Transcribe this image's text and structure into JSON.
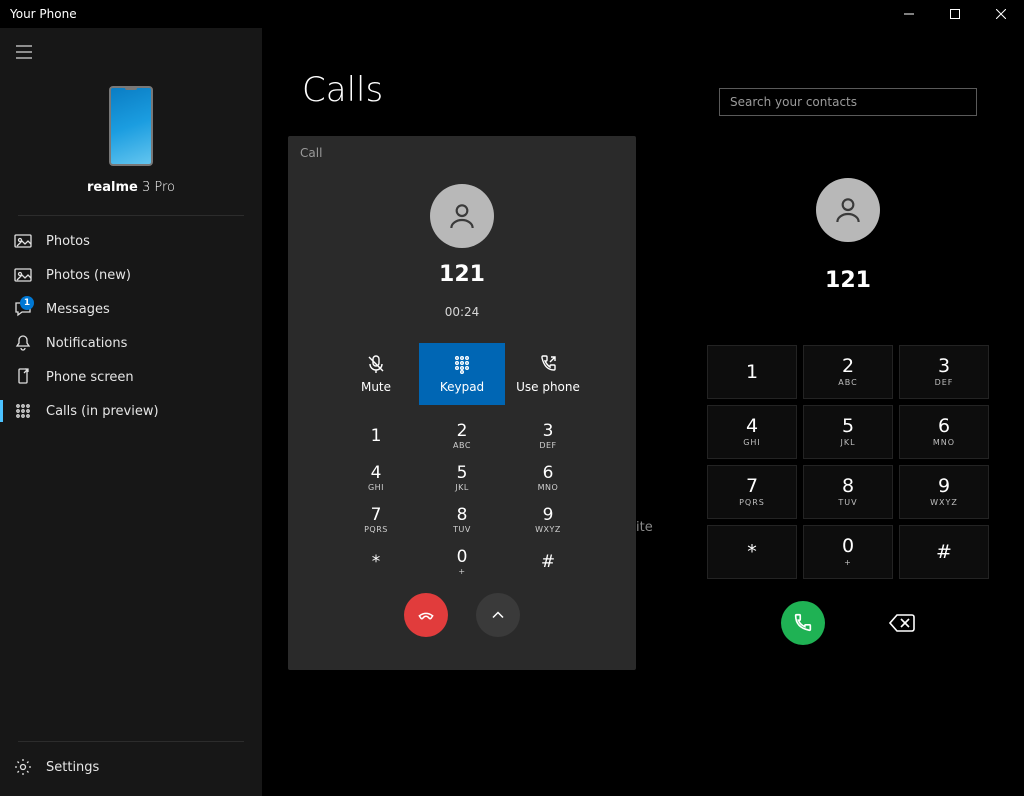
{
  "titlebar": {
    "title": "Your Phone"
  },
  "sidebar": {
    "phone_name_bold": "realme",
    "phone_name_light": " 3 Pro",
    "items": [
      {
        "label": "Photos"
      },
      {
        "label": "Photos (new)"
      },
      {
        "label": "Messages",
        "badge": "1"
      },
      {
        "label": "Notifications"
      },
      {
        "label": "Phone screen"
      },
      {
        "label": "Calls (in preview)"
      }
    ],
    "settings": "Settings"
  },
  "main": {
    "title": "Calls",
    "call_panel": {
      "header": "Call",
      "number": "121",
      "timer": "00:24",
      "actions": {
        "mute": "Mute",
        "keypad": "Keypad",
        "usephone": "Use phone"
      },
      "keypad": [
        {
          "n": "1",
          "l": ""
        },
        {
          "n": "2",
          "l": "ABC"
        },
        {
          "n": "3",
          "l": "DEF"
        },
        {
          "n": "4",
          "l": "GHI"
        },
        {
          "n": "5",
          "l": "JKL"
        },
        {
          "n": "6",
          "l": "MNO"
        },
        {
          "n": "7",
          "l": "PQRS"
        },
        {
          "n": "8",
          "l": "TUV"
        },
        {
          "n": "9",
          "l": "WXYZ"
        },
        {
          "n": "*",
          "l": ""
        },
        {
          "n": "0",
          "l": "+"
        },
        {
          "n": "#",
          "l": ""
        }
      ]
    },
    "dialer": {
      "search_placeholder": "Search your contacts",
      "number": "121",
      "keypad": [
        {
          "n": "1",
          "l": ""
        },
        {
          "n": "2",
          "l": "ABC"
        },
        {
          "n": "3",
          "l": "DEF"
        },
        {
          "n": "4",
          "l": "GHI"
        },
        {
          "n": "5",
          "l": "JKL"
        },
        {
          "n": "6",
          "l": "MNO"
        },
        {
          "n": "7",
          "l": "PQRS"
        },
        {
          "n": "8",
          "l": "TUV"
        },
        {
          "n": "9",
          "l": "WXYZ"
        },
        {
          "n": "*",
          "l": ""
        },
        {
          "n": "0",
          "l": "+"
        },
        {
          "n": "#",
          "l": ""
        }
      ]
    },
    "stray_text": "ite"
  }
}
